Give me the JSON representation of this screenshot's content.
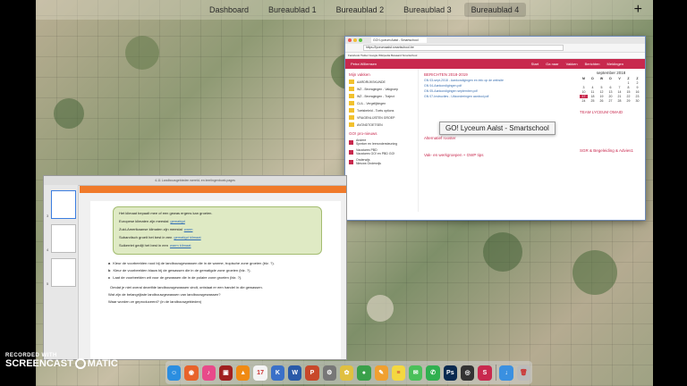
{
  "spaces": {
    "tabs": [
      "Dashboard",
      "Bureaublad 1",
      "Bureaublad 2",
      "Bureaublad 3",
      "Bureaublad 4"
    ],
    "active_index": 4,
    "add_label": "+"
  },
  "browser": {
    "tab_title": "GO! Lyceum Aalst - Smartschool",
    "url": "https://lyceumaalst.smartschool.be",
    "bookmarks": "Facebook  Twitter  Google  Wikipedia  Bewaard  Smartschool",
    "nav_user": "Petra Willemsen",
    "nav_links": [
      "Start",
      "Ga naar",
      "Vakken",
      "Berichten",
      "Meldingen"
    ],
    "left_title": "Mijn vakken",
    "tasks": [
      "AARDRIJKSKUNDE",
      "WZ - Bevragingen - Vakgroep",
      "WZ - Bevragingen - Traject",
      "CLIL - Vergelijkingen",
      "Toetsbeleid - Toets options",
      "VRAGENLIJSTEN GROEP",
      "AVONDTOETSEN"
    ],
    "groups_title": "GO! pro-nieuws",
    "groups": [
      {
        "name": "Andere",
        "sub": "Spreker en leerondersteuning"
      },
      {
        "name": "Vacatures PBD",
        "sub": "Vacatures GO! en PBD GO!"
      },
      {
        "name": "Onderwijs",
        "sub": "Nieuws Onderwijs"
      }
    ],
    "mid_title": "BERICHTEN 2018-2019",
    "mid_lines": [
      "GN 03-sept-2018 - Aankondigingen en info op de website",
      "GN 04-Aankondigingen.pdf",
      "GN 05-Aankondigingen september.pdf",
      "GN 07-Instructies - Uitzonderingen aanbod.pdf"
    ],
    "tooltip": "GO! Lyceum Aalst - Smartschool",
    "mid_section2": "Alternatief rooster",
    "mid_section3": "Vak- en werkgroepen + GWP tips",
    "calendar": {
      "title": "september 2018",
      "days": [
        "M",
        "D",
        "W",
        "D",
        "V",
        "Z",
        "Z"
      ],
      "dates": [
        "",
        "",
        "",
        "",
        "",
        "1",
        "2",
        "3",
        "4",
        "5",
        "6",
        "7",
        "8",
        "9",
        "10",
        "11",
        "12",
        "13",
        "14",
        "15",
        "16",
        "17",
        "18",
        "19",
        "20",
        "21",
        "22",
        "23",
        "24",
        "25",
        "26",
        "27",
        "28",
        "29",
        "30"
      ],
      "today": "17"
    },
    "right_note": "TEAM LYCEUM OMAID",
    "right_note2": "SGR & Begeleiding & Advies1"
  },
  "document": {
    "title": "4-11 Landbouwgebieden wereld- en leerlingenboek.pages",
    "green_lines": [
      {
        "text": "Het klimaat bepaalt mee of een gewas ergens kan groeien.",
        "fill": ""
      },
      {
        "text": "Europese klimaten zijn meestal",
        "fill": "gematigd"
      },
      {
        "text": "Zuid-Amerikaanse klimaten zijn meestal",
        "fill": "warm"
      },
      {
        "text": "Subarctisch groeit het best in een",
        "fill": "gematigd klimaat"
      },
      {
        "text": "Suikerriet gedijt het best in een",
        "fill": "warm klimaat"
      }
    ],
    "questions": [
      {
        "letter": "a",
        "text": "Kleur de voorbeelden rood bij de landbouwgewassen die in de warme, tropische zone groeien (blz. ?)."
      },
      {
        "letter": "b",
        "text": "Kleur de voorbeelden blauw bij de gewassen die in de gematigde zone groeien (blz. ?)."
      },
      {
        "letter": "c",
        "text": "Laat de voorbeelden wit voor de gewassen die in de polaire zone groeien (blz. ?)."
      }
    ],
    "intro": "Omdat je niet overal dezelfde landbouwgewassen vindt, ontstaat er een handel in die gewassen.",
    "question_d": "Wat zijn de belangrijkste landbouwgewassen van landbouwgewassen?",
    "question_e": "Waar worden ze geproduceerd? (in de landbouwgebieden)",
    "thumb_numbers": [
      "3",
      "4",
      "5"
    ]
  },
  "dock": {
    "apps": [
      {
        "name": "finder-icon",
        "color": "#2b8ee0",
        "glyph": "☺"
      },
      {
        "name": "firefox-icon",
        "color": "#e8632a",
        "glyph": "◉"
      },
      {
        "name": "itunes-icon",
        "color": "#e84a8a",
        "glyph": "♪"
      },
      {
        "name": "photo-booth-icon",
        "color": "#a02020",
        "glyph": "▣"
      },
      {
        "name": "vlc-icon",
        "color": "#f08a12",
        "glyph": "▲"
      },
      {
        "name": "calendar-icon",
        "color": "#f4f4f4",
        "glyph": "17"
      },
      {
        "name": "keynote-icon",
        "color": "#3a70c8",
        "glyph": "K"
      },
      {
        "name": "word-icon",
        "color": "#2a5aa8",
        "glyph": "W"
      },
      {
        "name": "powerpoint-icon",
        "color": "#c8482a",
        "glyph": "P"
      },
      {
        "name": "system-prefs-icon",
        "color": "#777",
        "glyph": "⚙"
      },
      {
        "name": "photos-icon",
        "color": "#e0c040",
        "glyph": "✿"
      },
      {
        "name": "chrome-icon",
        "color": "#3aa04a",
        "glyph": "●"
      },
      {
        "name": "pages-icon",
        "color": "#f0a030",
        "glyph": "✎"
      },
      {
        "name": "notes-icon",
        "color": "#f4d840",
        "glyph": "≡"
      },
      {
        "name": "messages-icon",
        "color": "#4ac05a",
        "glyph": "✉"
      },
      {
        "name": "whatsapp-icon",
        "color": "#30b050",
        "glyph": "✆"
      },
      {
        "name": "photoshop-icon",
        "color": "#0a2a50",
        "glyph": "Ps"
      },
      {
        "name": "camera-icon",
        "color": "#333",
        "glyph": "◎"
      },
      {
        "name": "smartschool-icon",
        "color": "#c8294e",
        "glyph": "S"
      },
      {
        "name": "downloads-icon",
        "color": "#3a90e0",
        "glyph": "↓"
      },
      {
        "name": "trash-icon",
        "color": "#bbb",
        "glyph": "🗑"
      }
    ]
  },
  "watermark": {
    "recorded_with": "RECORDED WITH",
    "brand_left": "SCREENCAST",
    "brand_right": "MATIC"
  }
}
